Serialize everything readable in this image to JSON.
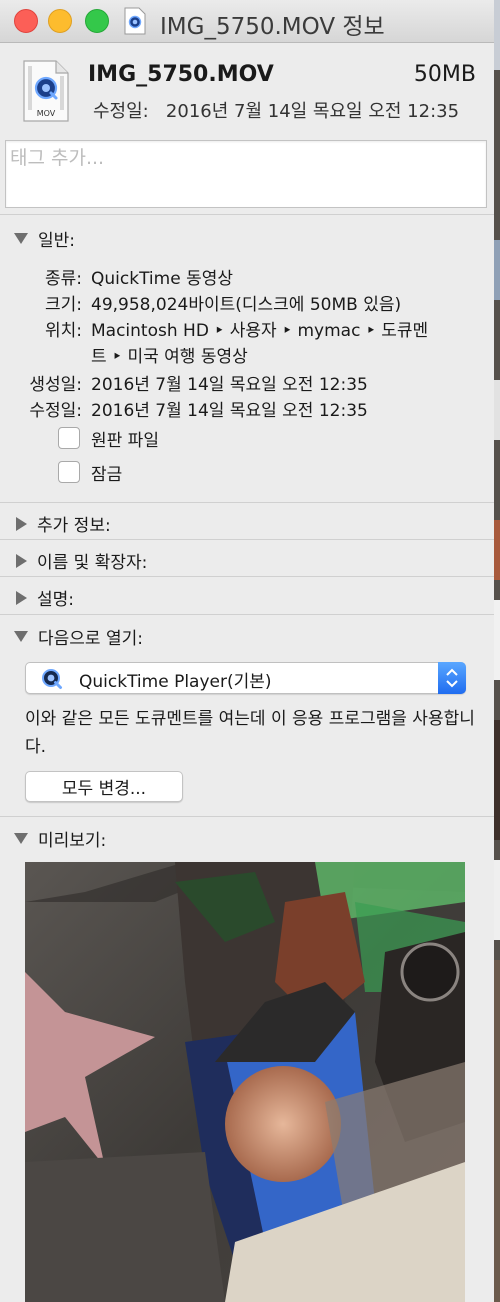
{
  "window": {
    "title": "IMG_5750.MOV 정보"
  },
  "header": {
    "file_name": "IMG_5750.MOV",
    "file_size": "50MB",
    "modified_label": "수정일:",
    "modified_value": "2016년 7월 14일 목요일 오전 12:35",
    "icon_badge": "MOV"
  },
  "tags": {
    "placeholder": "태그 추가..."
  },
  "general": {
    "title": "일반:",
    "kind_label": "종류:",
    "kind_value": "QuickTime 동영상",
    "size_label": "크기:",
    "size_value": "49,958,024바이트(디스크에 50MB 있음)",
    "where_label": "위치:",
    "where_line1": "Macintosh HD ‣ 사용자 ‣ mymac ‣ 도큐멘",
    "where_line2": "트 ‣ 미국 여행 동영상",
    "created_label": "생성일:",
    "created_value": "2016년 7월 14일 목요일 오전 12:35",
    "modified_label": "수정일:",
    "modified_value": "2016년 7월 14일 목요일 오전 12:35",
    "stationery_label": "원판 파일",
    "locked_label": "잠금"
  },
  "sections": {
    "more_info": "추가 정보:",
    "name_extension": "이름 및 확장자:",
    "comments": "설명:",
    "open_with": "다음으로 열기:",
    "preview": "미리보기:"
  },
  "open_with": {
    "app": "QuickTime Player(기본)",
    "description": "이와 같은 모든 도큐멘트를 여는데 이 응용 프로그램을 사용합니다.",
    "change_all": "모두 변경..."
  },
  "colors": {
    "accent": "#1f6cf0",
    "close": "#fc5f57",
    "minimize": "#fdbc2e",
    "maximize": "#34c84a"
  }
}
